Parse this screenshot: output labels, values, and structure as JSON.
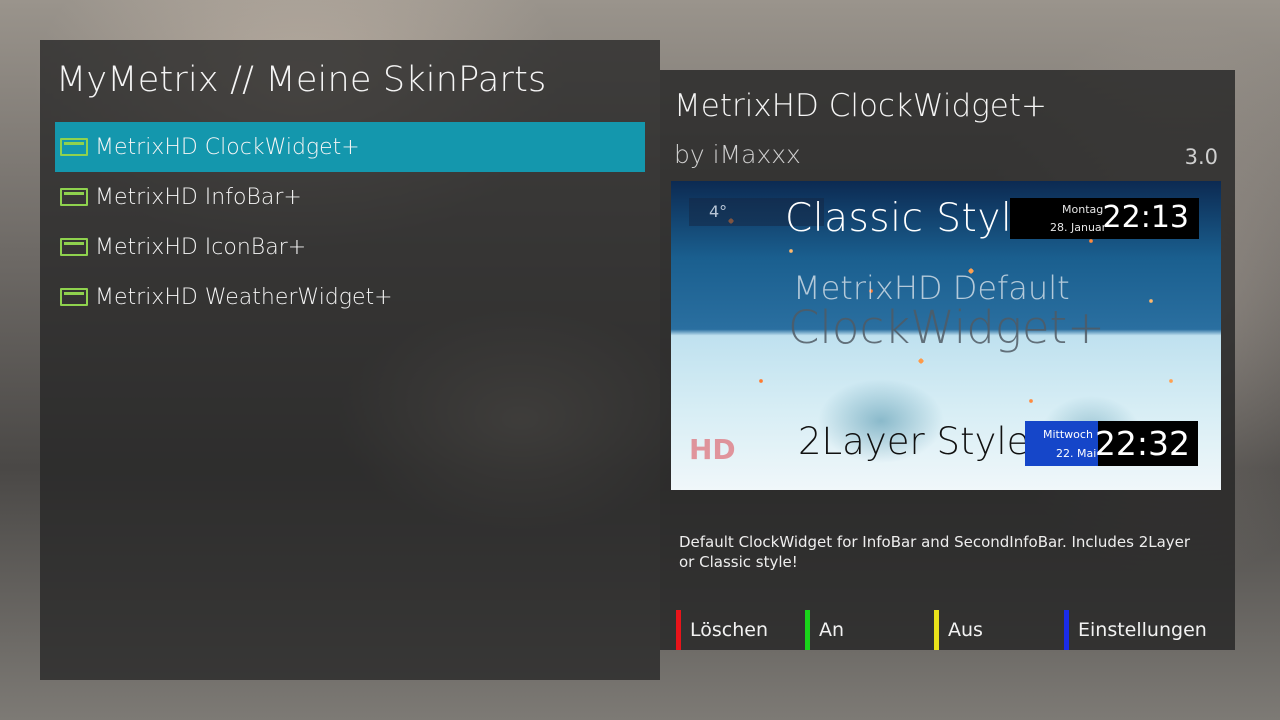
{
  "left": {
    "title": "MyMetrix // Meine SkinParts",
    "items": [
      {
        "label": "MetrixHD ClockWidget+",
        "selected": true
      },
      {
        "label": "MetrixHD InfoBar+",
        "selected": false
      },
      {
        "label": "MetrixHD IconBar+",
        "selected": false
      },
      {
        "label": "MetrixHD WeatherWidget+",
        "selected": false
      }
    ]
  },
  "detail": {
    "title": "MetrixHD ClockWidget+",
    "author": "by iMaxxx",
    "version": "3.0",
    "description": "Default ClockWidget for InfoBar and SecondInfoBar. Includes 2Layer or Classic style!",
    "preview": {
      "top_indicator": "4°",
      "classic_label": "Classic Style",
      "classic_day": "Montag",
      "classic_date": "28. Januar",
      "classic_time": "22:13",
      "center_line1": "MetrixHD Default",
      "center_line2": "ClockWidget+",
      "logo_text": "HD",
      "layer_label": "2Layer Style",
      "layer_day": "Mittwoch",
      "layer_date": "22. Mai",
      "layer_time": "22:32"
    }
  },
  "buttons": {
    "red": {
      "label": "Löschen",
      "color": "#e8141a"
    },
    "green": {
      "label": "An",
      "color": "#19d41a"
    },
    "yellow": {
      "label": "Aus",
      "color": "#e9e21a"
    },
    "blue": {
      "label": "Einstellungen",
      "color": "#1a2ce8"
    }
  },
  "colors": {
    "selection": "#1497ad",
    "icon": "#8fd24e"
  },
  "icons": {
    "list_item_icon": "skinpart-window-icon"
  }
}
